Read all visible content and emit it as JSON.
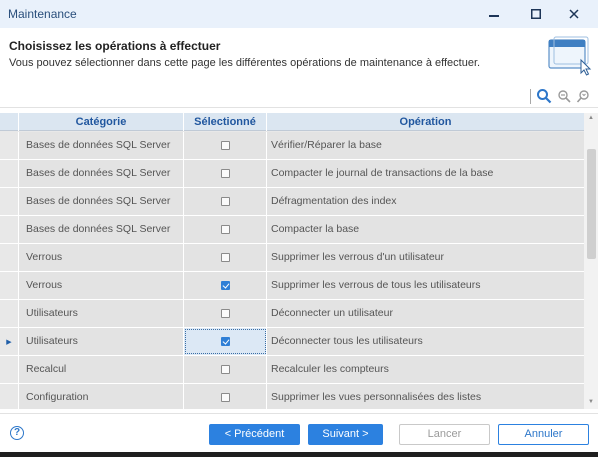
{
  "window": {
    "title": "Maintenance",
    "minimize_glyph": "—",
    "maximize_glyph": "☐",
    "close_glyph": "✕"
  },
  "header": {
    "title": "Choisissez les opérations à effectuer",
    "subtitle": "Vous pouvez sélectionner dans cette page les différentes opérations de maintenance à effectuer.",
    "icon": "window-cursor-icon"
  },
  "toolbar": {
    "icons": [
      "search-icon",
      "zoom-out-icon",
      "zoom-reset-icon"
    ]
  },
  "grid": {
    "columns": [
      "Catégorie",
      "Sélectionné",
      "Opération"
    ],
    "rows": [
      {
        "category": "Bases de données SQL Server",
        "selected": false,
        "operation": "Vérifier/Réparer la base",
        "current": false
      },
      {
        "category": "Bases de données SQL Server",
        "selected": false,
        "operation": "Compacter le journal de transactions de la base",
        "current": false
      },
      {
        "category": "Bases de données SQL Server",
        "selected": false,
        "operation": "Défragmentation des index",
        "current": false
      },
      {
        "category": "Bases de données SQL Server",
        "selected": false,
        "operation": "Compacter la base",
        "current": false
      },
      {
        "category": "Verrous",
        "selected": false,
        "operation": "Supprimer les verrous d'un utilisateur",
        "current": false
      },
      {
        "category": "Verrous",
        "selected": true,
        "operation": "Supprimer les verrous de tous les utilisateurs",
        "current": false
      },
      {
        "category": "Utilisateurs",
        "selected": false,
        "operation": "Déconnecter un utilisateur",
        "current": false
      },
      {
        "category": "Utilisateurs",
        "selected": true,
        "operation": "Déconnecter tous les utilisateurs",
        "current": true
      },
      {
        "category": "Recalcul",
        "selected": false,
        "operation": "Recalculer les compteurs",
        "current": false
      },
      {
        "category": "Configuration",
        "selected": false,
        "operation": "Supprimer les vues personnalisées des listes",
        "current": false
      }
    ]
  },
  "footer": {
    "help_glyph": "?",
    "prev_label": "< Précédent",
    "next_label": "Suivant >",
    "launch_label": "Lancer",
    "cancel_label": "Annuler"
  },
  "colors": {
    "accent": "#2c81e0",
    "header_text": "#21579f",
    "titlebar_bg": "#e9f1fb"
  }
}
